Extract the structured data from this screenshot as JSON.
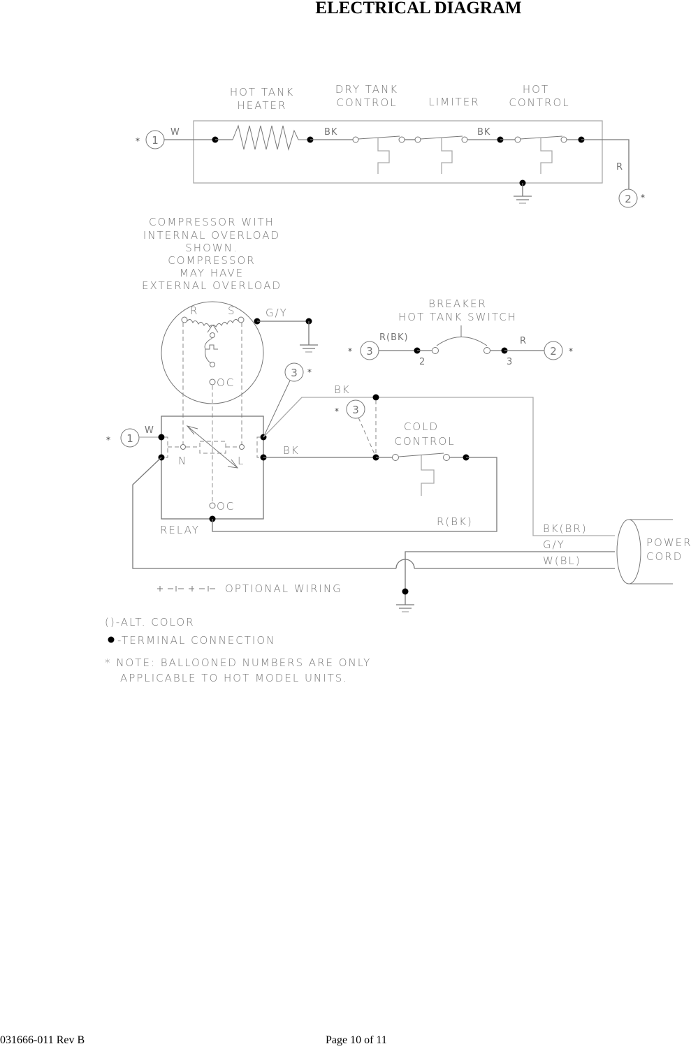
{
  "page": {
    "title": "ELECTRICAL DIAGRAM",
    "footer_left": "031666-011 Rev B",
    "footer_right": "Page 10 of 11"
  },
  "hot_circuit": {
    "labels": {
      "heater": [
        "HOT TANK",
        "HEATER"
      ],
      "dry_tank": [
        "DRY TANK",
        "CONTROL"
      ],
      "limiter": "LIMITER",
      "hot_control": [
        "HOT",
        "CONTROL"
      ]
    },
    "wires": {
      "w": "W",
      "bk1": "BK",
      "bk2": "BK",
      "r": "R"
    },
    "balloons": {
      "left": "1",
      "right": "2"
    }
  },
  "compressor": {
    "note": [
      "COMPRESSOR WITH",
      "INTERNAL OVERLOAD",
      "SHOWN.",
      "COMPRESSOR",
      "MAY HAVE",
      "EXTERNAL OVERLOAD"
    ],
    "r": "R",
    "s": "S",
    "oc": "OC",
    "ground_wire": "G/Y"
  },
  "breaker": {
    "labels": [
      "BREAKER",
      "HOT TANK SWITCH"
    ],
    "left_wire": "R(BK)",
    "right_wire": "R",
    "pin_left": "2",
    "pin_right": "3",
    "balloon_left": "3",
    "balloon_right": "2"
  },
  "relay": {
    "label": "RELAY",
    "n": "N",
    "l": "L",
    "oc": "OC",
    "w_wire": "W",
    "balloon_w": "1",
    "balloon_top": "3"
  },
  "cold_control": {
    "labels": [
      "COLD",
      "CONTROL"
    ],
    "bk_top": "BK",
    "bk_mid": "BK",
    "r_bk": "R(BK)",
    "balloon": "3"
  },
  "power_cord": {
    "labels": [
      "POWER",
      "CORD"
    ],
    "wires": [
      "BK(BR)",
      "G/Y",
      "W(BL)"
    ]
  },
  "legend": {
    "optional": "OPTIONAL WIRING",
    "alt_color": "()-ALT. COLOR",
    "terminal": "-TERMINAL CONNECTION",
    "note": [
      "* NOTE: BALLOONED NUMBERS ARE ONLY",
      "APPLICABLE TO HOT MODEL UNITS."
    ]
  },
  "symbols": {
    "asterisk": "*"
  }
}
